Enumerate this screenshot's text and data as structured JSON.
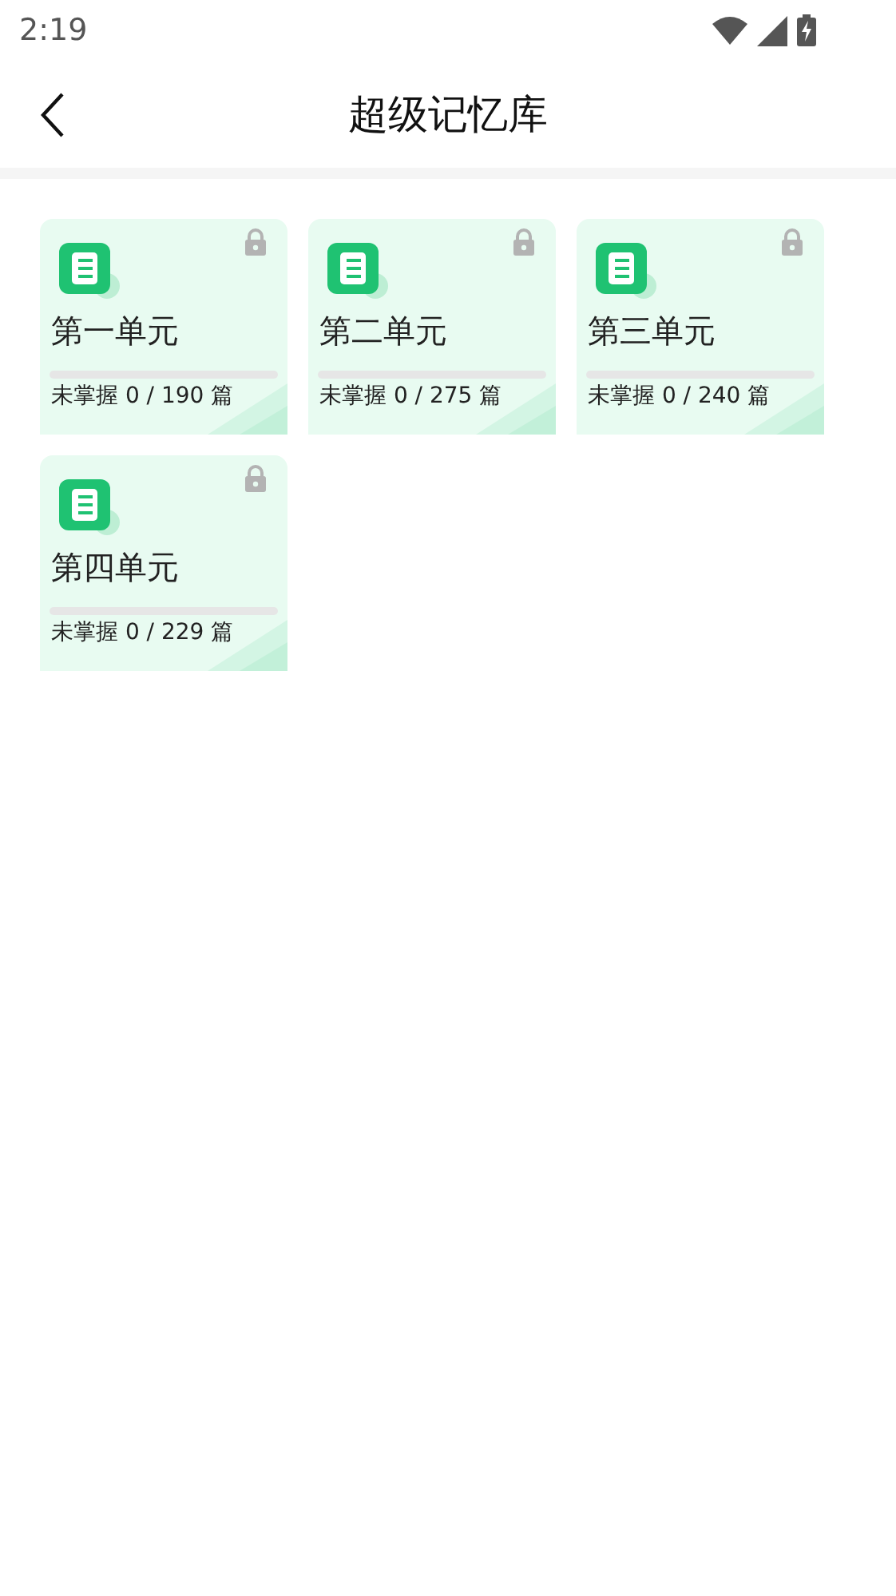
{
  "status_bar": {
    "time": "2:19"
  },
  "header": {
    "title": "超级记忆库"
  },
  "units": [
    {
      "title": "第一单元",
      "locked": true,
      "level": 0,
      "progress_text": "未掌握 0 / 190 篇"
    },
    {
      "title": "第二单元",
      "locked": true,
      "level": 0,
      "progress_text": "未掌握 0 / 275 篇"
    },
    {
      "title": "第三单元",
      "locked": true,
      "level": 0,
      "progress_text": "未掌握 0 / 240 篇"
    },
    {
      "title": "第四单元",
      "locked": true,
      "level": 0,
      "progress_text": "未掌握 0 / 229 篇"
    }
  ]
}
